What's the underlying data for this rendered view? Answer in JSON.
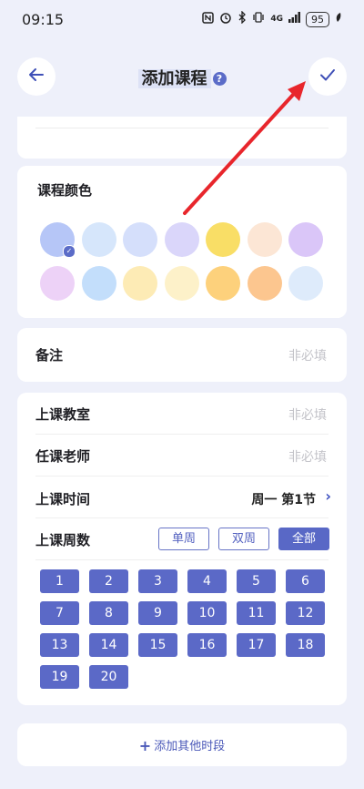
{
  "status_bar": {
    "time": "09:15",
    "battery": "95",
    "network": "4G"
  },
  "header": {
    "title": "添加课程",
    "help_glyph": "?",
    "back_icon": "back-arrow-icon",
    "confirm_icon": "check-icon"
  },
  "color_section": {
    "title": "课程颜色",
    "selected_index": 0,
    "swatches": [
      "#B6C6F7",
      "#D6E6FB",
      "#D5DFFB",
      "#DAD6FA",
      "#F9DE66",
      "#FCE6D5",
      "#DAC6F8",
      "#EDD2F7",
      "#C3DEFB",
      "#FDEBB5",
      "#FDF1C9",
      "#FDD17C",
      "#FCC68F",
      "#DEEBFB"
    ]
  },
  "note": {
    "label": "备注",
    "placeholder": "非必填"
  },
  "classroom": {
    "label": "上课教室",
    "placeholder": "非必填"
  },
  "teacher": {
    "label": "任课老师",
    "placeholder": "非必填"
  },
  "class_time": {
    "label": "上课时间",
    "value": "周一 第1节"
  },
  "weeks": {
    "label": "上课周数",
    "filters": [
      "单周",
      "双周",
      "全部"
    ],
    "active_filter": "全部",
    "numbers": [
      "1",
      "2",
      "3",
      "4",
      "5",
      "6",
      "7",
      "8",
      "9",
      "10",
      "11",
      "12",
      "13",
      "14",
      "15",
      "16",
      "17",
      "18",
      "19",
      "20"
    ]
  },
  "add_period": {
    "plus": "+",
    "label": "添加其他时段"
  },
  "colors": {
    "accent": "#5B69C7",
    "annotation_arrow": "#E8262C"
  }
}
